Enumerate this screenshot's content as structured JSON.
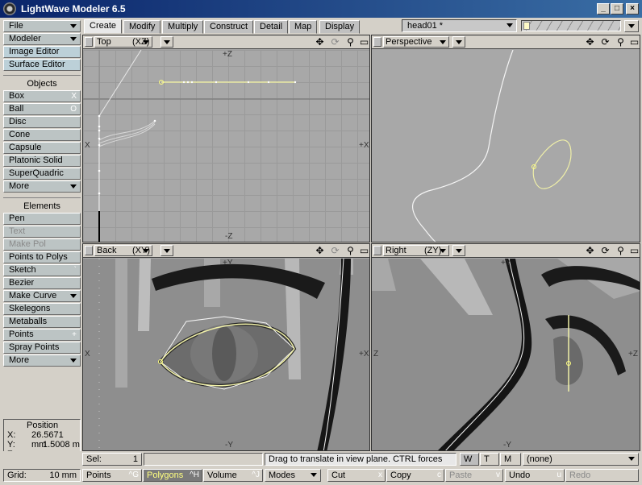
{
  "window": {
    "title": "LightWave Modeler 6.5",
    "buttons": [
      "_",
      "□",
      "×"
    ]
  },
  "top_left_menus": [
    {
      "label": "File"
    },
    {
      "label": "Modeler"
    }
  ],
  "tabs": [
    {
      "label": "Create",
      "active": true
    },
    {
      "label": "Modify"
    },
    {
      "label": "Multiply"
    },
    {
      "label": "Construct"
    },
    {
      "label": "Detail"
    },
    {
      "label": "Map"
    },
    {
      "label": "Display"
    }
  ],
  "object_selector": {
    "value": "head01 *"
  },
  "left_tools": {
    "editors": [
      "Image Editor",
      "Surface Editor"
    ],
    "objects_header": "Objects",
    "objects": [
      {
        "label": "Box",
        "key": "X"
      },
      {
        "label": "Ball",
        "key": "O"
      },
      {
        "label": "Disc",
        "key": ""
      },
      {
        "label": "Cone",
        "key": ""
      },
      {
        "label": "Capsule",
        "key": ""
      },
      {
        "label": "Platonic Solid",
        "key": ""
      },
      {
        "label": "SuperQuadric",
        "key": ""
      },
      {
        "label": "More",
        "key": ""
      }
    ],
    "elements_header": "Elements",
    "elements": [
      {
        "label": "Pen",
        "key": ""
      },
      {
        "label": "Text",
        "key": "",
        "disabled": true
      },
      {
        "label": "Make Pol",
        "key": "",
        "disabled": true
      },
      {
        "label": "Points to Polys",
        "key": ""
      },
      {
        "label": "Sketch",
        "key": "`"
      },
      {
        "label": "Bezier",
        "key": ""
      },
      {
        "label": "Make Curve",
        "key": ""
      },
      {
        "label": "Skelegons",
        "key": ""
      },
      {
        "label": "Metaballs",
        "key": ""
      },
      {
        "label": "Points",
        "key": "+"
      },
      {
        "label": "Spray Points",
        "key": ""
      },
      {
        "label": "More",
        "key": ""
      }
    ]
  },
  "position": {
    "title": "Position",
    "x_label": "X:",
    "x_value": "26.5671 mm",
    "y_label": "Y:",
    "y_value": "1.5008 m",
    "z_label": "Z:",
    "z_value": ""
  },
  "grid": {
    "label": "Grid:",
    "value": "10 mm"
  },
  "viewports": {
    "top": {
      "name": "Top",
      "axes": "(XZ)",
      "labels": {
        "top": "+Z",
        "bottom": "-Z",
        "left": "X",
        "right": "+X"
      }
    },
    "perspective": {
      "name": "Perspective"
    },
    "back": {
      "name": "Back",
      "axes": "(XY)",
      "labels": {
        "top": "+Y",
        "bottom": "-Y",
        "left": "X",
        "right": "+X"
      }
    },
    "right": {
      "name": "Right",
      "axes": "(ZY)",
      "labels": {
        "top": "+Y",
        "bottom": "-Y",
        "left": "Z",
        "right": "+Z"
      }
    }
  },
  "status": {
    "sel_label": "Sel:",
    "sel_value": "1",
    "message": "Drag to translate in view plane. CTRL forces on...",
    "wtm": [
      "W",
      "T",
      "M"
    ],
    "surface": "(none)"
  },
  "bottom": {
    "modes": [
      {
        "label": "Points",
        "key": "^G"
      },
      {
        "label": "Polygons",
        "key": "^H",
        "active": true
      },
      {
        "label": "Volume",
        "key": "^J"
      }
    ],
    "modes_menu": "Modes",
    "edit": [
      {
        "label": "Cut",
        "key": "x"
      },
      {
        "label": "Copy",
        "key": "c"
      },
      {
        "label": "Paste",
        "key": "v",
        "disabled": true
      },
      {
        "label": "Undo",
        "key": "u"
      },
      {
        "label": "Redo",
        "key": "",
        "disabled": true
      }
    ]
  }
}
